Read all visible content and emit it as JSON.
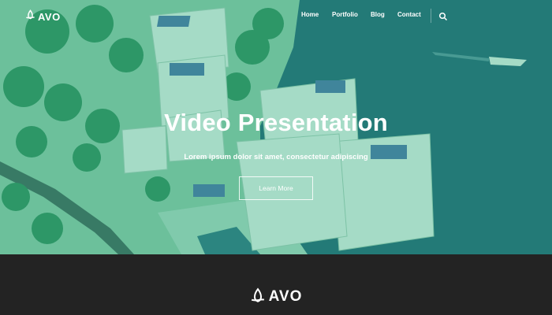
{
  "brand": {
    "name": "AVO",
    "logo_icon": "triquetra-icon"
  },
  "nav": {
    "items": [
      {
        "label": "Home"
      },
      {
        "label": "Portfolio"
      },
      {
        "label": "Blog"
      },
      {
        "label": "Contact"
      }
    ],
    "search_icon": "search-icon"
  },
  "hero": {
    "title": "Video Presentation",
    "subtitle": "Lorem ipsum dolor sit amet, consectetur adipiscing",
    "button_label": "Learn More",
    "background": "aerial-coastal-city-photo"
  },
  "footer": {
    "brand_name": "AVO"
  },
  "colors": {
    "overlay_tint": "#2bb085",
    "footer_bg": "#232323",
    "text": "#ffffff"
  }
}
